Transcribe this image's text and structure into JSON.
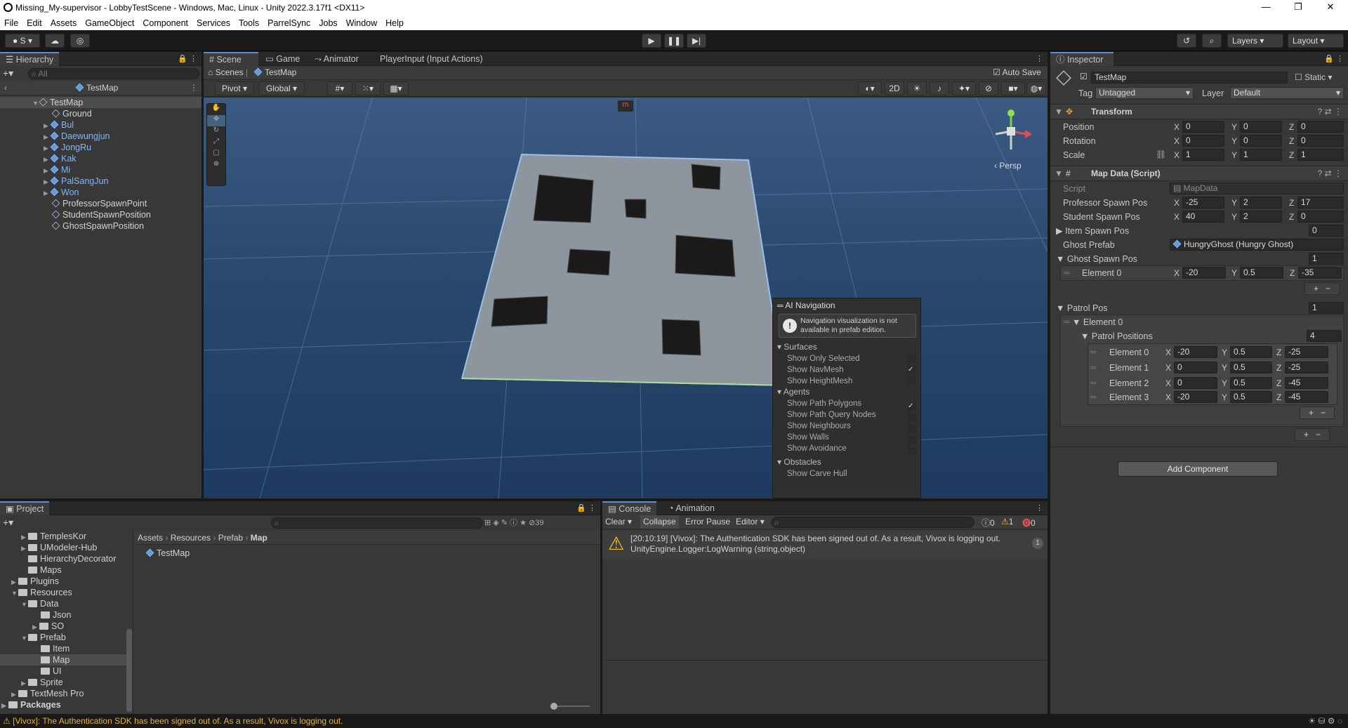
{
  "window": {
    "title": "Missing_My-supervisor - LobbyTestScene - Windows, Mac, Linux - Unity 2022.3.17f1 <DX11>"
  },
  "menu": [
    "File",
    "Edit",
    "Assets",
    "GameObject",
    "Component",
    "Services",
    "Tools",
    "ParrelSync",
    "Jobs",
    "Window",
    "Help"
  ],
  "toolbar": {
    "account": "S",
    "layers": "Layers",
    "layout": "Layout"
  },
  "hierarchy": {
    "tab": "Hierarchy",
    "search_placeholder": "All",
    "root": "TestMap",
    "map": "TestMap",
    "items": [
      "Ground",
      "Bul",
      "Daewungjun",
      "JongRu",
      "Kak",
      "Mi",
      "PalSangJun",
      "Won",
      "ProfessorSpawnPoint",
      "StudentSpawnPosition",
      "GhostSpawnPosition"
    ]
  },
  "scene": {
    "tabs": [
      "Scene",
      "Game",
      "Animator",
      "PlayerInput (Input Actions)"
    ],
    "breadcrumb": [
      "Scenes",
      "TestMap"
    ],
    "auto_save": "Auto Save",
    "pivot": "Pivot",
    "global": "Global",
    "mode2d": "2D",
    "persp": "Persp",
    "ai_nav": {
      "title": "AI Navigation",
      "warning": "Navigation visualization is not available in prefab edition.",
      "surfaces": "Surfaces",
      "surface_items": [
        "Show Only Selected",
        "Show NavMesh",
        "Show HeightMesh"
      ],
      "agents": "Agents",
      "agent_items": [
        "Show Path Polygons",
        "Show Path Query Nodes",
        "Show Neighbours",
        "Show Walls",
        "Show Avoidance"
      ],
      "obstacles": "Obstacles",
      "obstacle_items": [
        "Show Carve Hull"
      ]
    }
  },
  "inspector": {
    "tab": "Inspector",
    "name": "TestMap",
    "static": "Static",
    "tag_label": "Tag",
    "tag": "Untagged",
    "layer_label": "Layer",
    "layer": "Default",
    "transform": {
      "title": "Transform",
      "position_label": "Position",
      "position": [
        "0",
        "0",
        "0"
      ],
      "rotation_label": "Rotation",
      "rotation": [
        "0",
        "0",
        "0"
      ],
      "scale_label": "Scale",
      "scale": [
        "1",
        "1",
        "1"
      ]
    },
    "map_data": {
      "title": "Map Data (Script)",
      "script_label": "Script",
      "script": "MapData",
      "prof_label": "Professor Spawn Pos",
      "prof": [
        "-25",
        "2",
        "17"
      ],
      "student_label": "Student Spawn Pos",
      "student": [
        "40",
        "2",
        "0"
      ],
      "item_label": "Item Spawn Pos",
      "item_count": "0",
      "ghost_prefab_label": "Ghost Prefab",
      "ghost_prefab": "HungryGhost (Hungry Ghost)",
      "ghost_spawn_label": "Ghost Spawn Pos",
      "ghost_spawn_count": "1",
      "ghost_el_label": "Element 0",
      "ghost_el": [
        "-20",
        "0.5",
        "-35"
      ],
      "patrol_label": "Patrol Pos",
      "patrol_count": "1",
      "patrol_el_label": "Element 0",
      "patrol_positions_label": "Patrol Positions",
      "patrol_positions_count": "4",
      "patrol_elements": [
        {
          "label": "Element 0",
          "v": [
            "-20",
            "0.5",
            "-25"
          ]
        },
        {
          "label": "Element 1",
          "v": [
            "0",
            "0.5",
            "-25"
          ]
        },
        {
          "label": "Element 2",
          "v": [
            "0",
            "0.5",
            "-45"
          ]
        },
        {
          "label": "Element 3",
          "v": [
            "-20",
            "0.5",
            "-45"
          ]
        }
      ]
    },
    "add_component": "Add Component"
  },
  "project": {
    "tab": "Project",
    "count": "39",
    "tree": [
      "TemplesKor",
      "UModeler-Hub",
      "HierarchyDecorator",
      "Maps",
      "Plugins",
      "Resources",
      "Data",
      "Json",
      "SO",
      "Prefab",
      "Item",
      "Map",
      "UI",
      "Sprite",
      "TextMesh Pro",
      "Packages"
    ],
    "path": [
      "Assets",
      "Resources",
      "Prefab",
      "Map"
    ],
    "files": [
      "TestMap"
    ]
  },
  "console": {
    "tabs": [
      "Console",
      "Animation"
    ],
    "buttons": [
      "Clear",
      "Collapse",
      "Error Pause",
      "Editor"
    ],
    "counts": [
      "0",
      "1",
      "0"
    ],
    "message1": "[20:10:19] [Vivox]: The Authentication SDK has been signed out of. As a result, Vivox is logging out.",
    "message2": "UnityEngine.Logger:LogWarning (string,object)",
    "msg_count": "1"
  },
  "status": {
    "message": "[Vivox]: The Authentication SDK has been signed out of. As a result, Vivox is logging out."
  }
}
